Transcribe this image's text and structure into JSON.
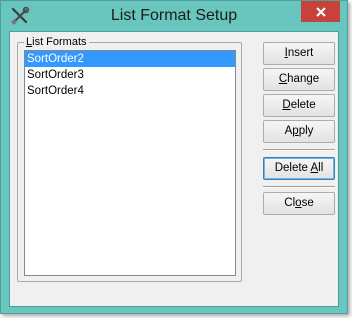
{
  "window": {
    "title": "List Format Setup",
    "icons": {
      "app": "tools-icon",
      "close": "close-icon"
    },
    "colors": {
      "frame": "#68c6bf",
      "close": "#c7423a",
      "selection": "#3399ff"
    }
  },
  "group": {
    "label_prefix": "L",
    "label_rest": "ist Formats"
  },
  "list": {
    "items": [
      "SortOrder2",
      "SortOrder3",
      "SortOrder4"
    ],
    "selected_index": 0
  },
  "buttons": {
    "insert": {
      "mnemonic": "I",
      "rest": "nsert"
    },
    "change": {
      "mnemonic": "C",
      "rest": "hange"
    },
    "delete": {
      "mnemonic": "D",
      "rest": "elete"
    },
    "apply": {
      "pre": "A",
      "mnemonic": "p",
      "rest": "ply"
    },
    "delete_all": {
      "pre": "Delete ",
      "mnemonic": "A",
      "rest": "ll"
    },
    "close": {
      "pre": "Cl",
      "mnemonic": "o",
      "rest": "se"
    }
  }
}
